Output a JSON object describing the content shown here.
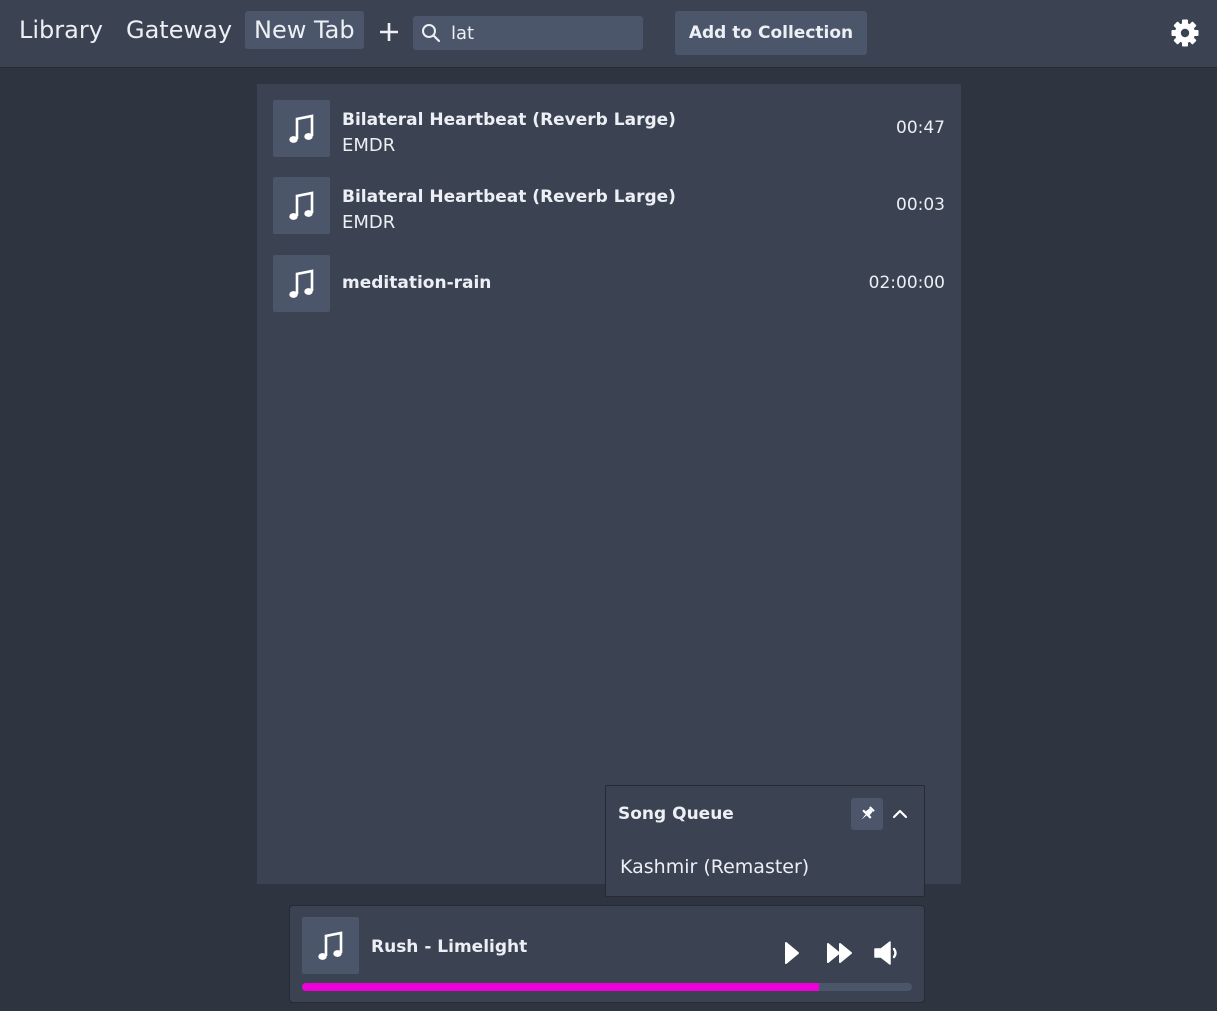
{
  "tabs": [
    {
      "label": "Library"
    },
    {
      "label": "Gateway"
    },
    {
      "label": "New Tab",
      "active": true
    }
  ],
  "search": {
    "value": "lat",
    "icon": "search-icon"
  },
  "toolbar": {
    "add_to_collection_label": "Add to Collection"
  },
  "results": [
    {
      "title": "Bilateral Heartbeat (Reverb Large)",
      "artist": "EMDR",
      "duration": "00:47"
    },
    {
      "title": "Bilateral Heartbeat (Reverb Large)",
      "artist": "EMDR",
      "duration": "00:03"
    },
    {
      "title": "meditation-rain",
      "artist": "",
      "duration": "02:00:00"
    }
  ],
  "queue": {
    "title": "Song Queue",
    "items": [
      "Kashmir (Remaster)"
    ]
  },
  "player": {
    "now_playing": "Rush - Limelight",
    "progress_fraction": 0.847
  },
  "colors": {
    "background": "#2e3440",
    "panel": "#3b4252",
    "surface": "#4c566a",
    "text": "#eceff4",
    "progress_accent": "#f000d8"
  }
}
